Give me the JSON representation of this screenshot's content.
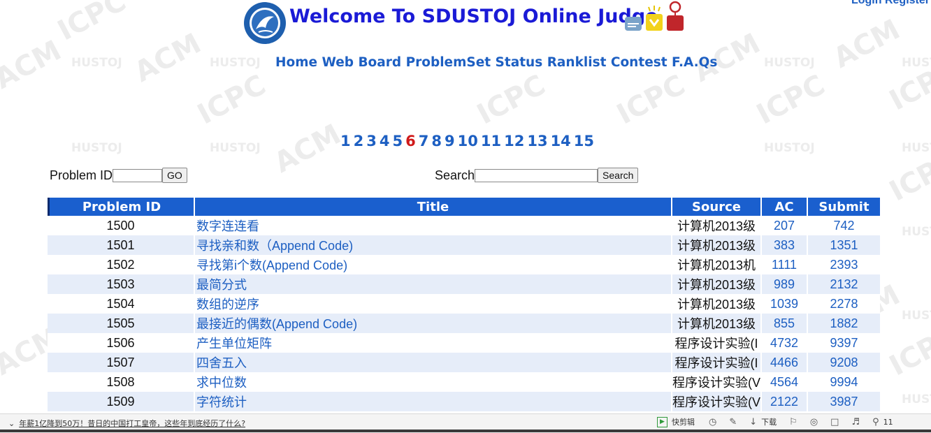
{
  "header": {
    "title": "Welcome To SDUSTOJ Online Judge",
    "login": "Login",
    "register": "Register"
  },
  "nav": {
    "home": "Home",
    "webboard": "Web Board",
    "problemset": "ProblemSet",
    "status": "Status",
    "ranklist": "Ranklist",
    "contest": "Contest",
    "faqs": "F.A.Qs"
  },
  "pager": {
    "pages": [
      "1",
      "2",
      "3",
      "4",
      "5",
      "6",
      "7",
      "8",
      "9",
      "10",
      "11",
      "12",
      "13",
      "14",
      "15"
    ],
    "current": "6"
  },
  "forms": {
    "problem_id_label": "Problem ID",
    "go_label": "GO",
    "problem_id_value": "",
    "search_label": "Search",
    "search_button": "Search",
    "search_value": ""
  },
  "table": {
    "headers": [
      "Problem ID",
      "Title",
      "Source",
      "AC",
      "Submit"
    ],
    "rows": [
      {
        "id": "1500",
        "title": "数字连连看",
        "source": "计算机2013级",
        "ac": "207",
        "submit": "742"
      },
      {
        "id": "1501",
        "title": "寻找亲和数（Append Code)",
        "source": "计算机2013级",
        "ac": "383",
        "submit": "1351"
      },
      {
        "id": "1502",
        "title": "寻找第i个数(Append Code)",
        "source": "计算机2013机",
        "ac": "1111",
        "submit": "2393"
      },
      {
        "id": "1503",
        "title": "最简分式",
        "source": "计算机2013级",
        "ac": "989",
        "submit": "2132"
      },
      {
        "id": "1504",
        "title": "数组的逆序",
        "source": "计算机2013级",
        "ac": "1039",
        "submit": "2278"
      },
      {
        "id": "1505",
        "title": "最接近的偶数(Append Code)",
        "source": "计算机2013级",
        "ac": "855",
        "submit": "1882"
      },
      {
        "id": "1506",
        "title": "产生单位矩阵",
        "source": "程序设计实验(I",
        "ac": "4732",
        "submit": "9397"
      },
      {
        "id": "1507",
        "title": "四舍五入",
        "source": "程序设计实验(I",
        "ac": "4466",
        "submit": "9208"
      },
      {
        "id": "1508",
        "title": "求中位数",
        "source": "程序设计实验(V",
        "ac": "4564",
        "submit": "9994"
      },
      {
        "id": "1509",
        "title": "字符统计",
        "source": "程序设计实验(V",
        "ac": "2122",
        "submit": "3987"
      }
    ]
  },
  "statusbar": {
    "news": "年薪1亿降到50万！昔日的中国打工皇帝，这些年到底经历了什么?",
    "quickclip": "快剪辑",
    "download": "下载",
    "zoom": "11"
  },
  "colors": {
    "title_blue": "#1a1ad6",
    "link_blue": "#1d5fc2",
    "header_bg": "#1a5fce",
    "current_page": "#d01a1a",
    "row_alt": "#e6edf9"
  },
  "icons": [
    "university-logo-icon",
    "decoration-icons",
    "chevron-down-icon",
    "quickclip-icon",
    "clock-icon",
    "pin-icon",
    "download-icon",
    "flag-icon",
    "browser-icon",
    "window-icon",
    "volume-icon",
    "magnifier-icon"
  ]
}
